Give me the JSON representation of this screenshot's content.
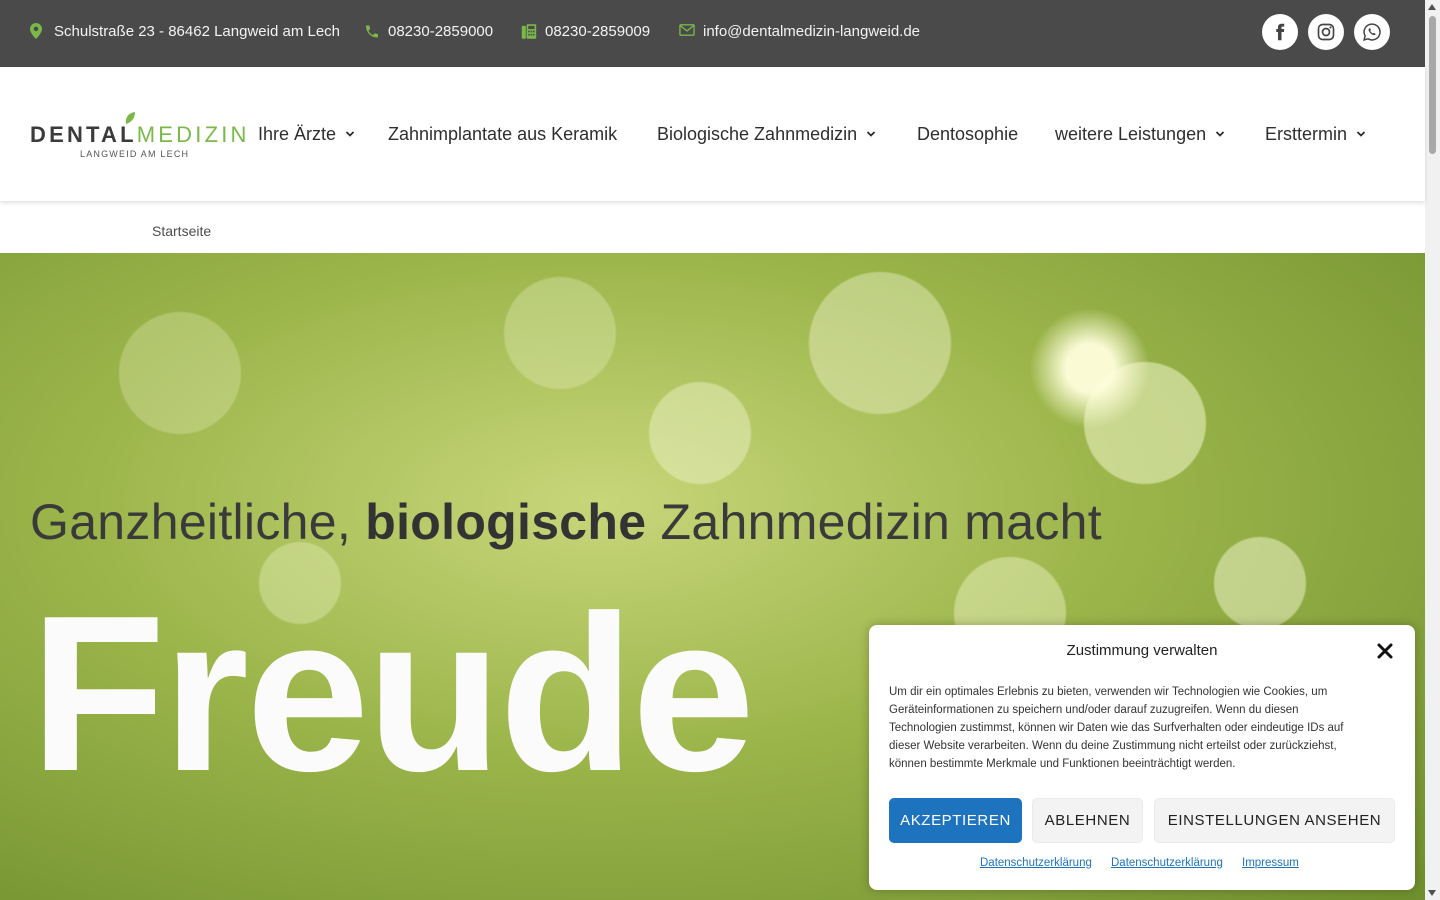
{
  "topbar": {
    "address": "Schulstraße 23 - 86462 Langweid am Lech",
    "phone": "08230-2859000",
    "fax": "08230-2859009",
    "email": "info@dentalmedizin-langweid.de",
    "icon_color": "#7bb84a",
    "social": [
      "facebook-icon",
      "instagram-icon",
      "whatsapp-icon"
    ]
  },
  "logo": {
    "word1": "DENTAL",
    "word2": "MEDIZIN",
    "tagline": "LANGWEID AM LECH"
  },
  "nav": {
    "items": [
      {
        "label": "Ihre Ärzte",
        "dropdown": true
      },
      {
        "label": "Zahnimplantate aus Keramik",
        "dropdown": false
      },
      {
        "label": "Biologische Zahnmedizin",
        "dropdown": true
      },
      {
        "label": "Dentosophie",
        "dropdown": false
      },
      {
        "label": "weitere Leistungen",
        "dropdown": true
      },
      {
        "label": "Ersttermin",
        "dropdown": true
      }
    ]
  },
  "breadcrumb": {
    "home": "Startseite"
  },
  "hero": {
    "line1_a": "Ganzheitliche, ",
    "line1_bold": "biologische",
    "line1_b": " Zahnmedizin macht",
    "big_word": "Freude"
  },
  "consent": {
    "title": "Zustimmung verwalten",
    "text": "Um dir ein optimales Erlebnis zu bieten, verwenden wir Technologien wie Cookies, um Geräteinformationen zu speichern und/oder darauf zuzugreifen. Wenn du diesen Technologien zustimmst, können wir Daten wie das Surfverhalten oder eindeutige IDs auf dieser Website verarbeiten. Wenn du deine Zustimmung nicht erteilst oder zurückziehst, können bestimmte Merkmale und Funktionen beeinträchtigt werden.",
    "accept": "AKZEPTIEREN",
    "deny": "ABLEHNEN",
    "settings": "EINSTELLUNGEN ANSEHEN",
    "links": [
      "Datenschutzerklärung",
      "Datenschutzerklärung",
      "Impressum"
    ],
    "accent": "#1e73be"
  }
}
